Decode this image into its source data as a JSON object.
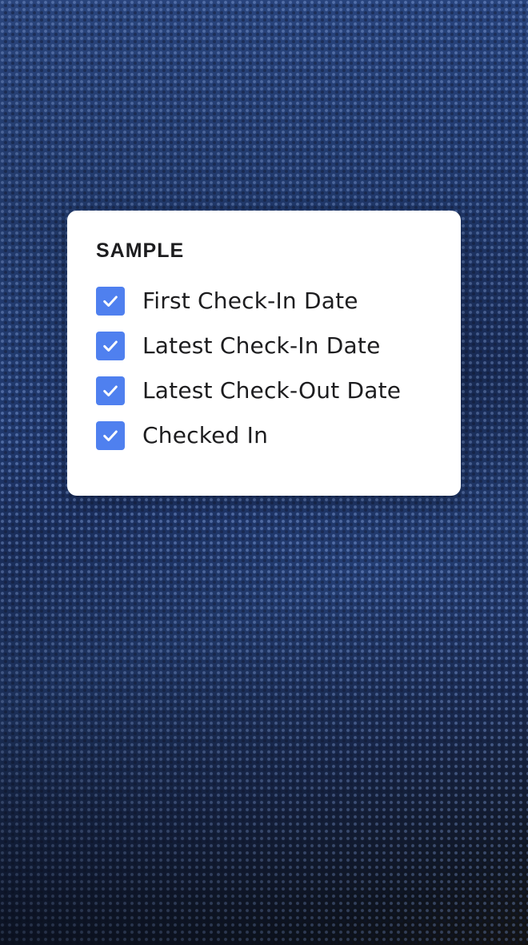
{
  "colors": {
    "checkbox_fill": "#4f80ef",
    "card_background": "#ffffff",
    "text": "#1d1d1f",
    "background": "#1c2f55"
  },
  "panel": {
    "title": "SAMPLE",
    "options": [
      {
        "label": "First Check-In Date",
        "checked": true,
        "icon": "checkmark-icon"
      },
      {
        "label": "Latest Check-In Date",
        "checked": true,
        "icon": "checkmark-icon"
      },
      {
        "label": "Latest Check-Out Date",
        "checked": true,
        "icon": "checkmark-icon"
      },
      {
        "label": "Checked In",
        "checked": true,
        "icon": "checkmark-icon"
      }
    ]
  }
}
